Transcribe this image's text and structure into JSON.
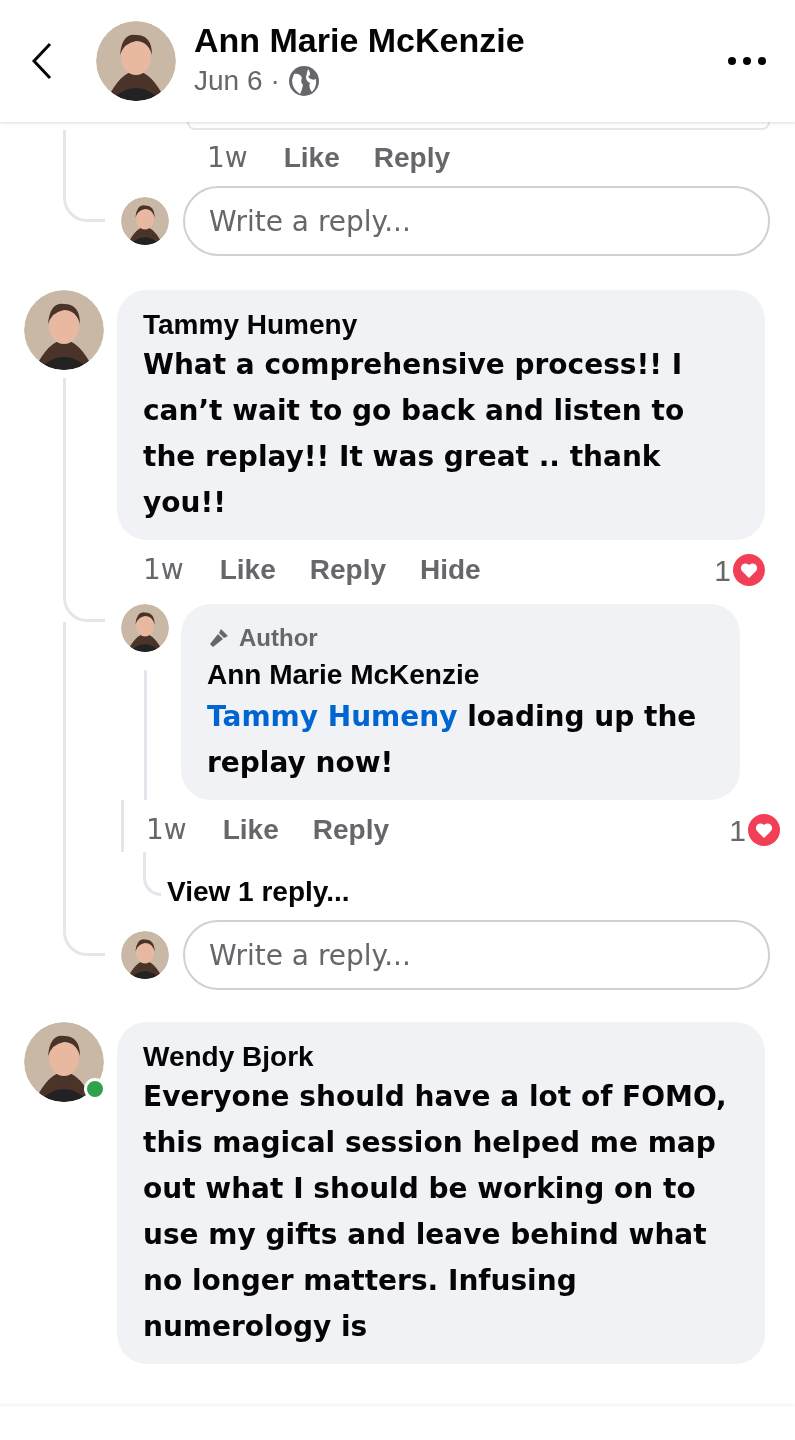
{
  "header": {
    "name": "Ann Marie McKenzie",
    "date": "Jun 6",
    "separator": "·"
  },
  "previous": {
    "actions": {
      "time": "1w",
      "buttons": [
        "Like",
        "Reply"
      ]
    },
    "reply_field": {
      "placeholder": "Write a reply..."
    }
  },
  "comments": [
    {
      "author": "Tammy Humeny",
      "online": false,
      "text": "What a comprehensive process!! I can’t wait to go back and listen to the replay!! It was great .. thank you!!",
      "actions": {
        "time": "1w",
        "buttons": [
          "Like",
          "Reply",
          "Hide"
        ]
      },
      "reactions": {
        "count": "1"
      },
      "replies": [
        {
          "badge": "Author",
          "author": "Ann Marie McKenzie",
          "mention": "Tammy Humeny",
          "text": "loading up the replay now!",
          "actions": {
            "time": "1w",
            "buttons": [
              "Like",
              "Reply"
            ]
          },
          "reactions": {
            "count": "1"
          },
          "view_replies": "View 1 reply..."
        }
      ],
      "reply_field": {
        "placeholder": "Write a reply..."
      }
    },
    {
      "author": "Wendy Bjork",
      "online": true,
      "text": "Everyone should have a lot of FOMO, this magical session helped me map out what I should be working on to use my gifts and leave behind what no longer matters. Infusing numerology is"
    }
  ]
}
